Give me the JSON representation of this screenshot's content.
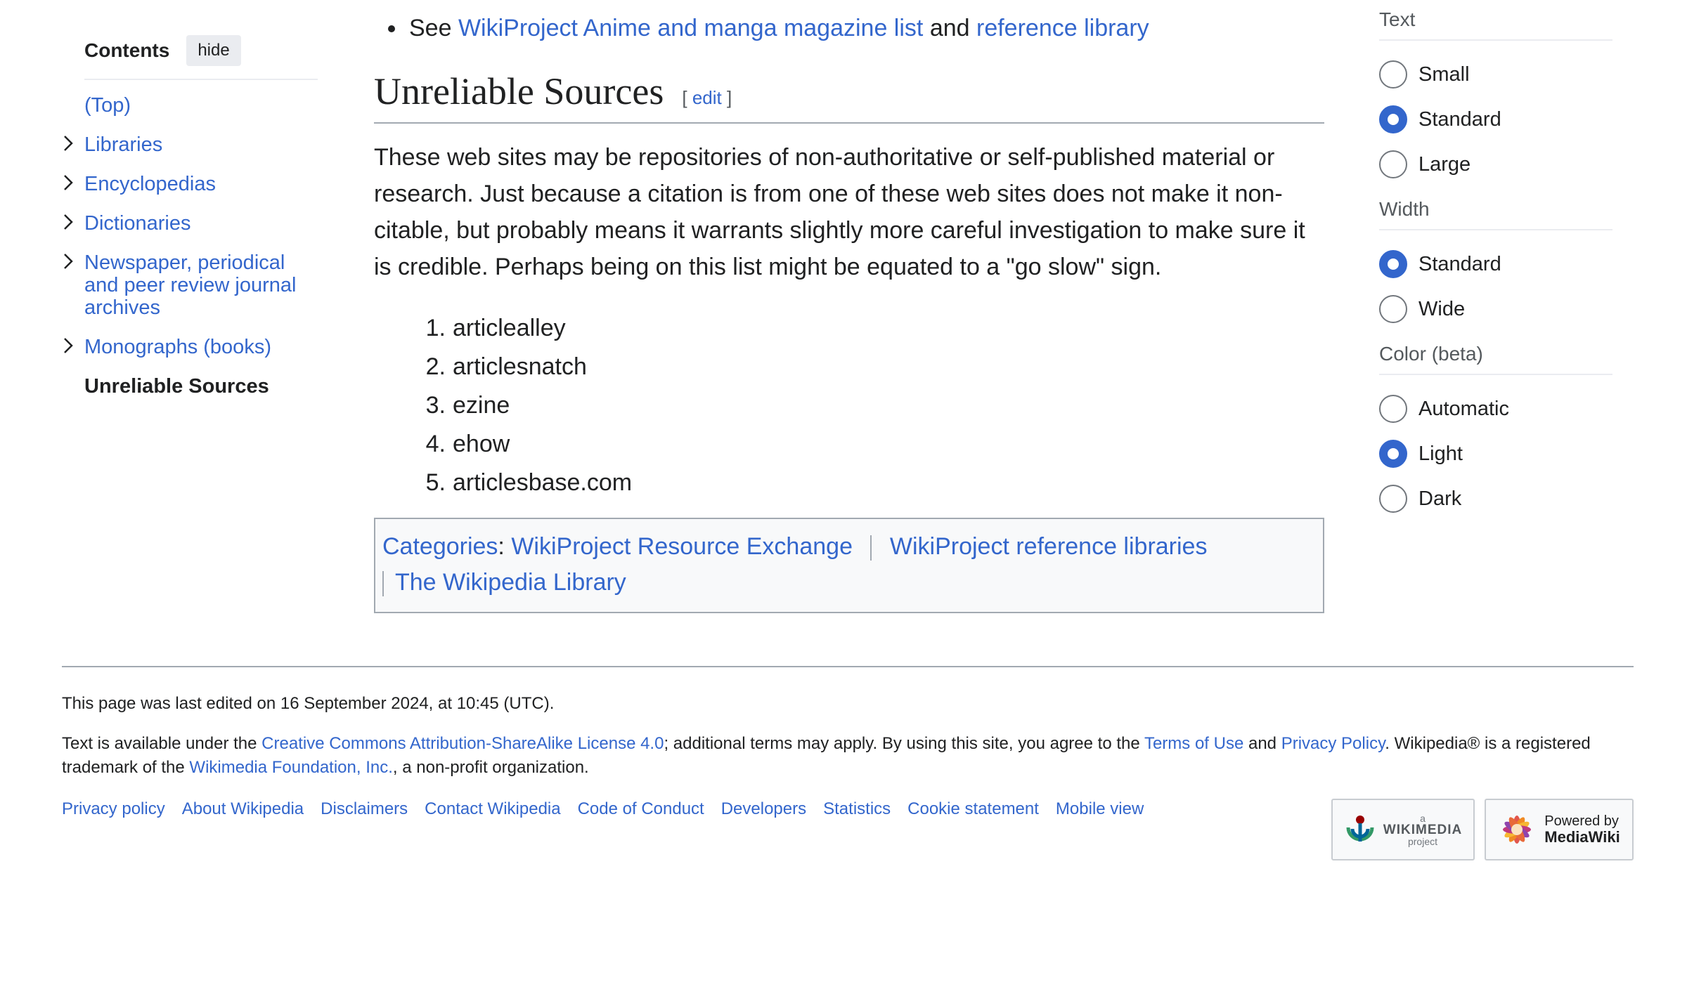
{
  "toc": {
    "title": "Contents",
    "hide_label": "hide",
    "items": [
      {
        "label": "(Top)"
      },
      {
        "label": "Libraries"
      },
      {
        "label": "Encyclopedias"
      },
      {
        "label": "Dictionaries"
      },
      {
        "label": "Newspaper, periodical and peer review journal archives"
      },
      {
        "label": "Monographs (books)"
      },
      {
        "label": "Unreliable Sources"
      }
    ]
  },
  "content": {
    "see_prefix": "See",
    "see_link1": "WikiProject Anime and manga magazine list",
    "see_and": "and",
    "see_link2": "reference library",
    "heading": "Unreliable Sources",
    "edit_open": "[",
    "edit_label": "edit",
    "edit_close": "]",
    "paragraph": "These web sites may be repositories of non-authoritative or self-published material or research. Just because a citation is from one of these web sites does not make it non-citable, but probably means it warrants slightly more careful investigation to make sure it is credible. Perhaps being on this list might be equated to a \"go slow\" sign.",
    "list": [
      {
        "num": "1.",
        "text": "articlealley"
      },
      {
        "num": "2.",
        "text": "articlesnatch"
      },
      {
        "num": "3.",
        "text": "ezine"
      },
      {
        "num": "4.",
        "text": "ehow"
      },
      {
        "num": "5.",
        "text": "articlesbase.com"
      }
    ],
    "categories": {
      "label": "Categories",
      "colon": ":",
      "items": [
        "WikiProject Resource Exchange",
        "WikiProject reference libraries",
        "The Wikipedia Library"
      ]
    }
  },
  "appearance": {
    "text": {
      "title": "Text",
      "options": [
        {
          "label": "Small",
          "checked": false
        },
        {
          "label": "Standard",
          "checked": true
        },
        {
          "label": "Large",
          "checked": false
        }
      ]
    },
    "width": {
      "title": "Width",
      "options": [
        {
          "label": "Standard",
          "checked": true
        },
        {
          "label": "Wide",
          "checked": false
        }
      ]
    },
    "color": {
      "title": "Color (beta)",
      "options": [
        {
          "label": "Automatic",
          "checked": false
        },
        {
          "label": "Light",
          "checked": true
        },
        {
          "label": "Dark",
          "checked": false
        }
      ]
    }
  },
  "footer": {
    "last_modified": "This page was last edited on 16 September 2024, at 10:45 (UTC).",
    "license_1": "Text is available under the ",
    "license_link_cc": "Creative Commons Attribution-ShareAlike License 4.0",
    "license_2": "; additional terms may apply. By using this site, you agree to the ",
    "license_link_terms": "Terms of Use",
    "license_3": " and ",
    "license_link_privacy": "Privacy Policy",
    "license_4": ". Wikipedia® is a registered trademark of the ",
    "license_link_wmf": "Wikimedia Foundation, Inc.",
    "license_5": ", a non-profit organization.",
    "links": [
      "Privacy policy",
      "About Wikipedia",
      "Disclaimers",
      "Contact Wikipedia",
      "Code of Conduct",
      "Developers",
      "Statistics",
      "Cookie statement",
      "Mobile view"
    ],
    "wikimedia_badge": {
      "small": "a",
      "big": "WIKIMEDIA",
      "small2": "project"
    },
    "mediawiki_badge": {
      "line1": "Powered by",
      "line2": "MediaWiki"
    }
  },
  "colors": {
    "link": "#3366cc",
    "text": "#202122",
    "border": "#a2a9b1",
    "radio_selected": "#3366cc"
  }
}
